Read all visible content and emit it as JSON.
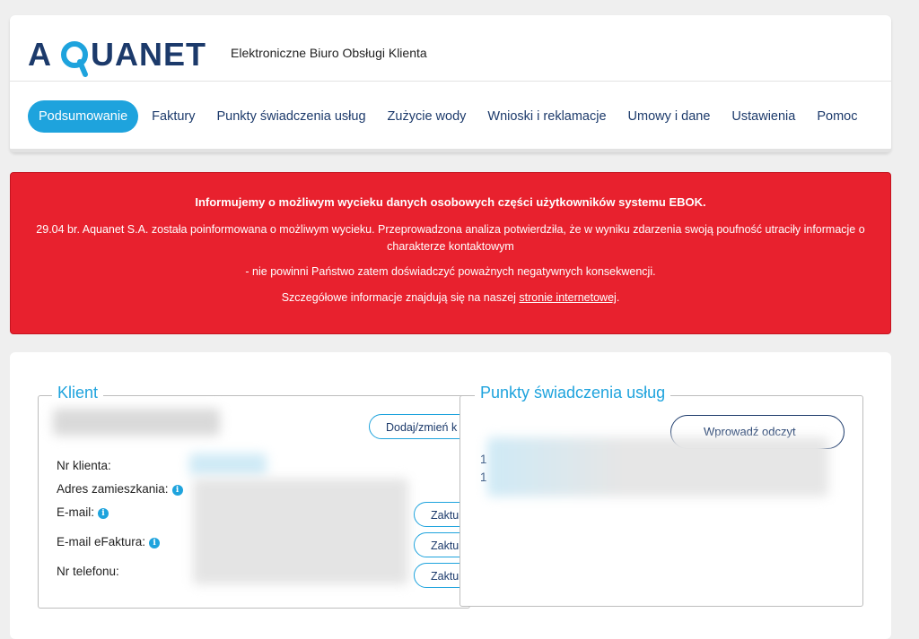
{
  "header": {
    "logo_text": "AQUANET",
    "subtitle": "Elektroniczne Biuro Obsługi Klienta"
  },
  "nav": {
    "items": [
      {
        "label": "Podsumowanie",
        "active": true
      },
      {
        "label": "Faktury"
      },
      {
        "label": "Punkty świadczenia usług"
      },
      {
        "label": "Zużycie wody"
      },
      {
        "label": "Wnioski i reklamacje"
      },
      {
        "label": "Umowy i dane"
      },
      {
        "label": "Ustawienia"
      },
      {
        "label": "Pomoc"
      }
    ]
  },
  "alert": {
    "title": "Informujemy o możliwym wycieku danych osobowych części użytkowników systemu EBOK.",
    "line1": "29.04 br. Aquanet S.A. została poinformowana o możliwym wycieku. Przeprowadzona analiza potwierdziła, że w wyniku zdarzenia swoją poufność utraciły informacje o charakterze kontaktowym",
    "line3": "- nie powinni Państwo zatem doświadczyć poważnych negatywnych konsekwencji.",
    "line4_prefix": "Szczegółowe informacje znajdują się na naszej ",
    "line4_link": "stronie internetowej",
    "line4_suffix": ".",
    "color": "#e8212e"
  },
  "klient": {
    "legend": "Klient",
    "add_button": "Dodaj/zmień k",
    "labels": {
      "client_number": "Nr klienta:",
      "address": "Adres zamieszkania:",
      "email": "E-mail:",
      "efaktura": "E-mail eFaktura:",
      "phone": "Nr telefonu:"
    },
    "update_button": "Zaktu",
    "info_glyph": "i"
  },
  "punkty": {
    "legend": "Punkty świadczenia usług",
    "enter_reading_button": "Wprowadź odczyt",
    "row_prefix": "1"
  },
  "colors": {
    "accent": "#1ea3dd",
    "navy": "#1c3a6b"
  }
}
